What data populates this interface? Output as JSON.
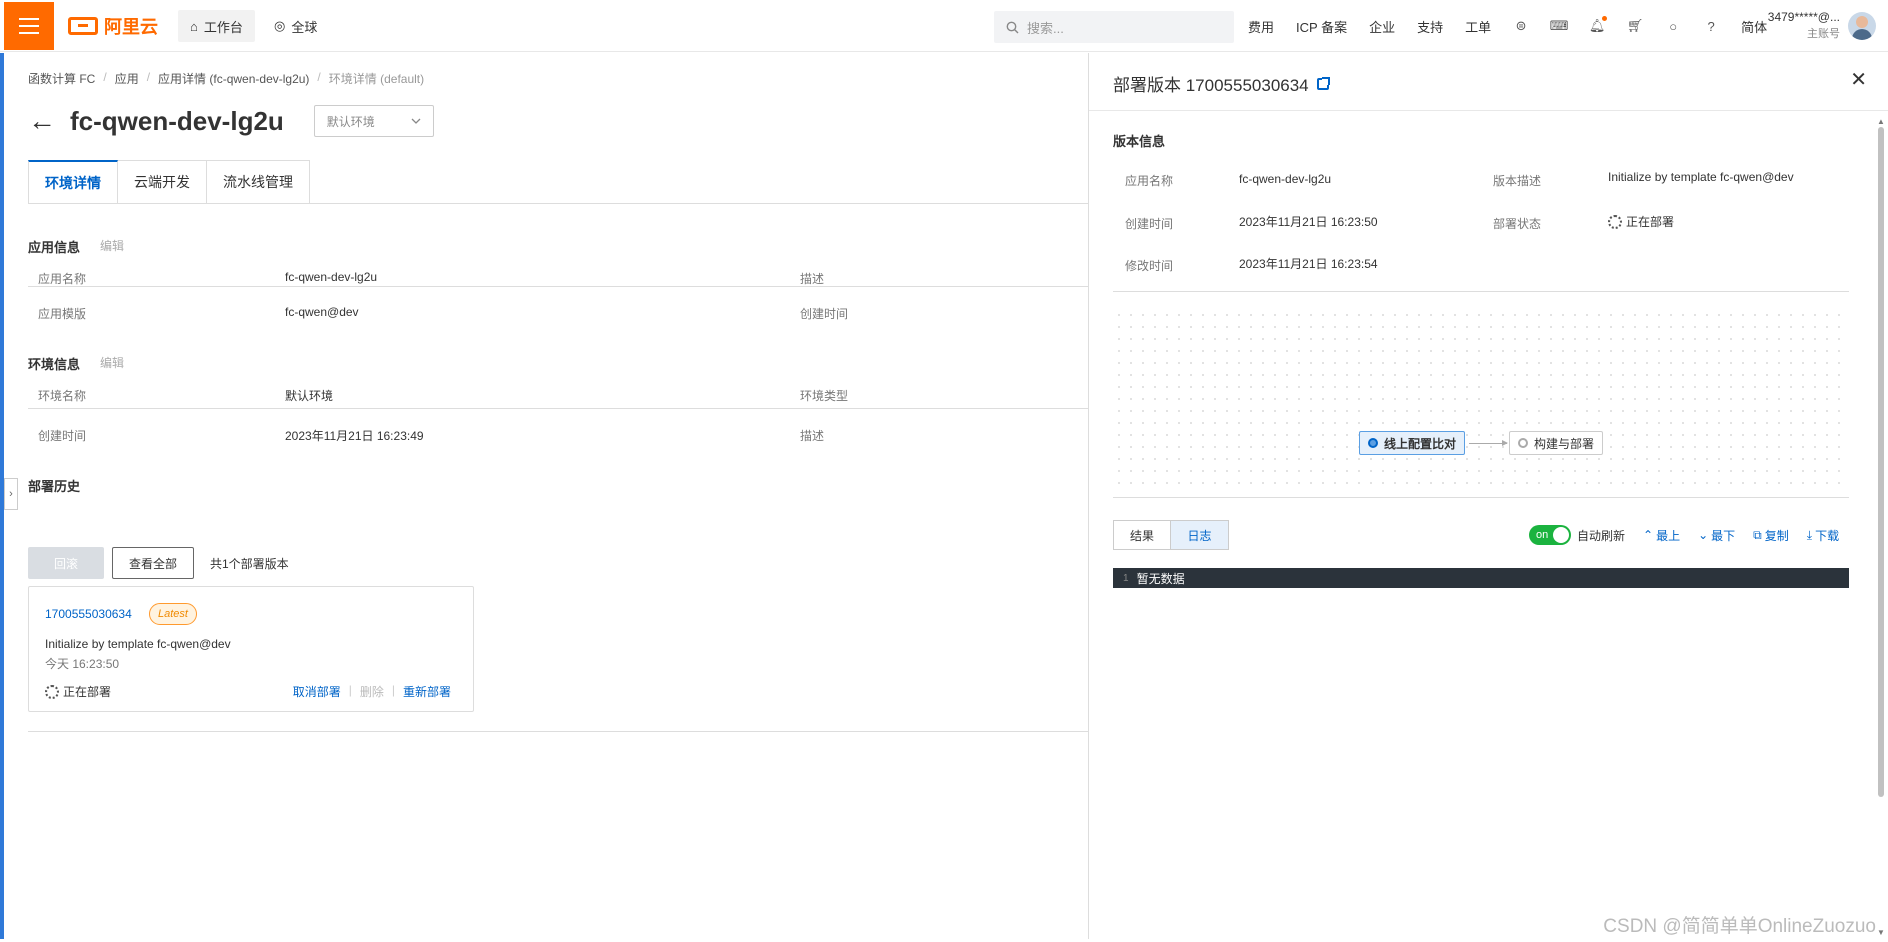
{
  "topbar": {
    "brand": "阿里云",
    "workspace_label": "工作台",
    "global_label": "全球",
    "search_placeholder": "搜索...",
    "nav": [
      "费用",
      "ICP 备案",
      "企业",
      "支持",
      "工单"
    ],
    "lang": "简体",
    "account_name": "3479*****@...",
    "account_sub": "主账号"
  },
  "breadcrumb": [
    "函数计算 FC",
    "应用",
    "应用详情 (fc-qwen-dev-lg2u)",
    "环境详情 (default)"
  ],
  "app": {
    "title": "fc-qwen-dev-lg2u",
    "env_select": "默认环境"
  },
  "tabs": [
    "环境详情",
    "云端开发",
    "流水线管理"
  ],
  "app_info": {
    "title": "应用信息",
    "edit": "编辑",
    "name_label": "应用名称",
    "name_value": "fc-qwen-dev-lg2u",
    "template_label": "应用模版",
    "template_value": "fc-qwen@dev",
    "desc_label": "描述",
    "created_label": "创建时间"
  },
  "env_info": {
    "title": "环境信息",
    "edit": "编辑",
    "name_label": "环境名称",
    "name_value": "默认环境",
    "created_label": "创建时间",
    "created_value": "2023年11月21日 16:23:49",
    "type_label": "环境类型",
    "desc_label": "描述"
  },
  "deploy_history": {
    "title": "部署历史",
    "rollback": "回滚",
    "view_all": "查看全部",
    "count_text": "共1个部署版本",
    "card": {
      "version": "1700555030634",
      "badge": "Latest",
      "desc": "Initialize by template fc-qwen@dev",
      "time": "今天 16:23:50",
      "status": "正在部署",
      "cancel": "取消部署",
      "delete": "删除",
      "redeploy": "重新部署"
    }
  },
  "panel": {
    "title": "部署版本 1700555030634",
    "section": "版本信息",
    "app_name_label": "应用名称",
    "app_name_value": "fc-qwen-dev-lg2u",
    "version_desc_label": "版本描述",
    "version_desc_value": "Initialize by template fc-qwen@dev",
    "created_label": "创建时间",
    "created_value": "2023年11月21日 16:23:50",
    "status_label": "部署状态",
    "status_value": "正在部署",
    "modified_label": "修改时间",
    "modified_value": "2023年11月21日 16:23:54",
    "flow": [
      "线上配置比对",
      "构建与部署"
    ],
    "seg_result": "结果",
    "seg_log": "日志",
    "toggle_text": "on",
    "auto_refresh": "自动刷新",
    "top": "最上",
    "bottom": "最下",
    "copy": "复制",
    "download": "下载",
    "console_line": "1",
    "console_text": "暂无数据"
  },
  "watermark": "CSDN @简简单单OnlineZuozuo"
}
